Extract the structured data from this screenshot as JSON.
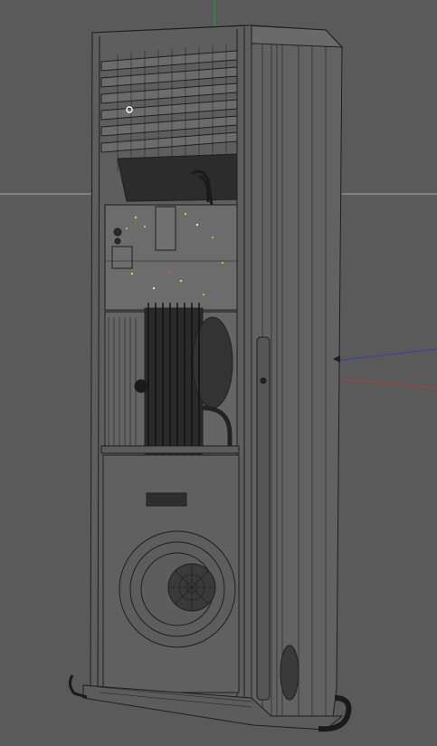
{
  "viewport": {
    "background_color": "#5a5a5a",
    "gizmo": {
      "y_axis_color": "#1fa13a",
      "x_axis_color": "#b23a3a",
      "z_axis_color": "#3a3ab8",
      "grid_line_color": "#a8a8a8"
    },
    "model": {
      "wire_color": "#1e1e1e",
      "shade_color": "#636363",
      "dark_color": "#2a2a2a"
    },
    "pivot_icon": "pivot-circle-icon"
  }
}
